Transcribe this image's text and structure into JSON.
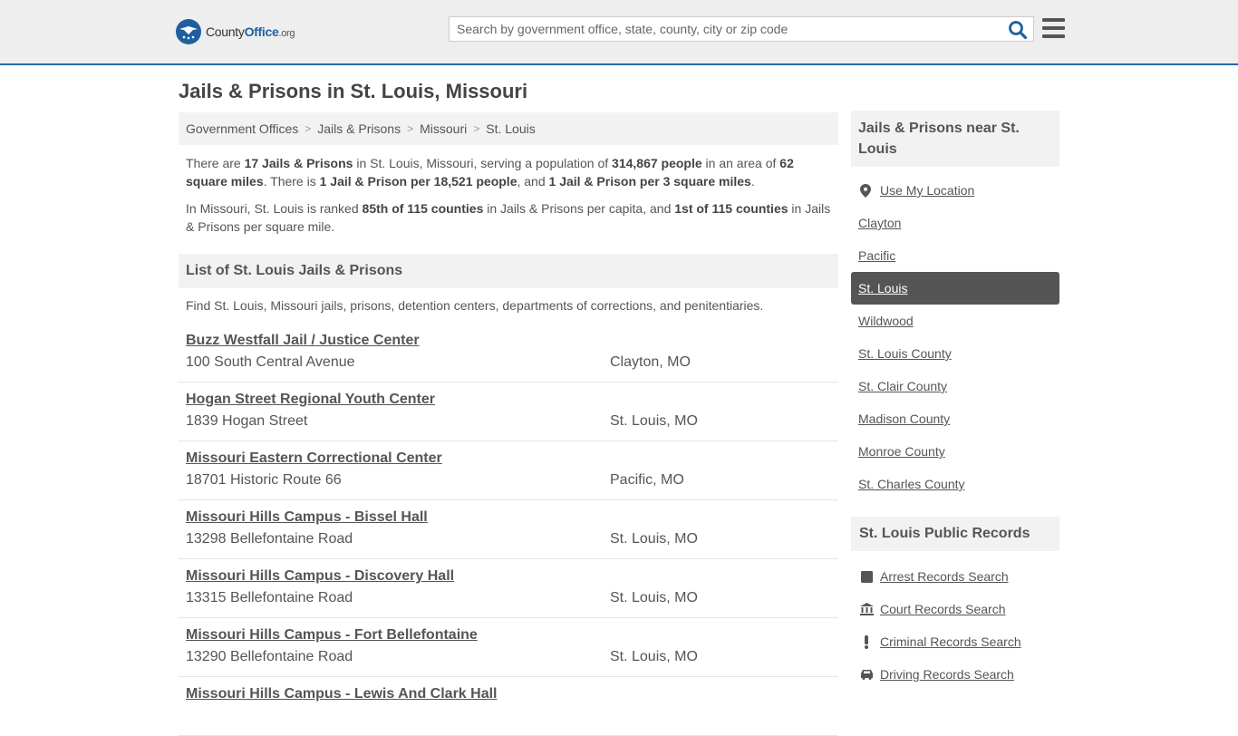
{
  "brand": {
    "name_prefix": "County",
    "name_accent": "Office",
    "tld": ".org",
    "color": "#1f5fa0"
  },
  "search": {
    "placeholder": "Search by government office, state, county, city or zip code"
  },
  "page": {
    "title": "Jails & Prisons in St. Louis, Missouri"
  },
  "breadcrumb": [
    "Government Offices",
    "Jails & Prisons",
    "Missouri",
    "St. Louis"
  ],
  "intro": {
    "p1": [
      {
        "t": "There are ",
        "b": false
      },
      {
        "t": "17 Jails & Prisons",
        "b": true
      },
      {
        "t": " in St. Louis, Missouri, serving a population of ",
        "b": false
      },
      {
        "t": "314,867 people",
        "b": true
      },
      {
        "t": " in an area of ",
        "b": false
      },
      {
        "t": "62 square miles",
        "b": true
      },
      {
        "t": ". There is ",
        "b": false
      },
      {
        "t": "1 Jail & Prison per 18,521 people",
        "b": true
      },
      {
        "t": ", and ",
        "b": false
      },
      {
        "t": "1 Jail & Prison per 3 square miles",
        "b": true
      },
      {
        "t": ".",
        "b": false
      }
    ],
    "p2": [
      {
        "t": "In Missouri, St. Louis is ranked ",
        "b": false
      },
      {
        "t": "85th of 115 counties",
        "b": true
      },
      {
        "t": " in Jails & Prisons per capita, and ",
        "b": false
      },
      {
        "t": "1st of 115 counties",
        "b": true
      },
      {
        "t": " in Jails & Prisons per square mile.",
        "b": false
      }
    ]
  },
  "list": {
    "title": "List of St. Louis Jails & Prisons",
    "description": "Find St. Louis, Missouri jails, prisons, detention centers, departments of corrections, and penitentiaries.",
    "items": [
      {
        "name": "Buzz Westfall Jail / Justice Center",
        "address": "100 South Central Avenue",
        "city": "Clayton, MO"
      },
      {
        "name": "Hogan Street Regional Youth Center",
        "address": "1839 Hogan Street",
        "city": "St. Louis, MO"
      },
      {
        "name": "Missouri Eastern Correctional Center",
        "address": "18701 Historic Route 66",
        "city": "Pacific, MO"
      },
      {
        "name": "Missouri Hills Campus - Bissel Hall",
        "address": "13298 Bellefontaine Road",
        "city": "St. Louis, MO"
      },
      {
        "name": "Missouri Hills Campus - Discovery Hall",
        "address": "13315 Bellefontaine Road",
        "city": "St. Louis, MO"
      },
      {
        "name": "Missouri Hills Campus - Fort Bellefontaine",
        "address": "13290 Bellefontaine Road",
        "city": "St. Louis, MO"
      },
      {
        "name": "Missouri Hills Campus - Lewis And Clark Hall",
        "address": "",
        "city": ""
      }
    ]
  },
  "sidebar": {
    "near_title": "Jails & Prisons near St. Louis",
    "near_items": [
      {
        "label": "Use My Location",
        "icon": "location-pin-icon",
        "active": false
      },
      {
        "label": "Clayton",
        "active": false
      },
      {
        "label": "Pacific",
        "active": false
      },
      {
        "label": "St. Louis",
        "active": true
      },
      {
        "label": "Wildwood",
        "active": false
      },
      {
        "label": "St. Louis County",
        "active": false
      },
      {
        "label": "St. Clair County",
        "active": false
      },
      {
        "label": "Madison County",
        "active": false
      },
      {
        "label": "Monroe County",
        "active": false
      },
      {
        "label": "St. Charles County",
        "active": false
      }
    ],
    "records_title": "St. Louis Public Records",
    "records_items": [
      {
        "label": "Arrest Records Search",
        "icon": "square-icon"
      },
      {
        "label": "Court Records Search",
        "icon": "courthouse-icon"
      },
      {
        "label": "Criminal Records Search",
        "icon": "exclamation-icon"
      },
      {
        "label": "Driving Records Search",
        "icon": "car-icon"
      }
    ]
  }
}
